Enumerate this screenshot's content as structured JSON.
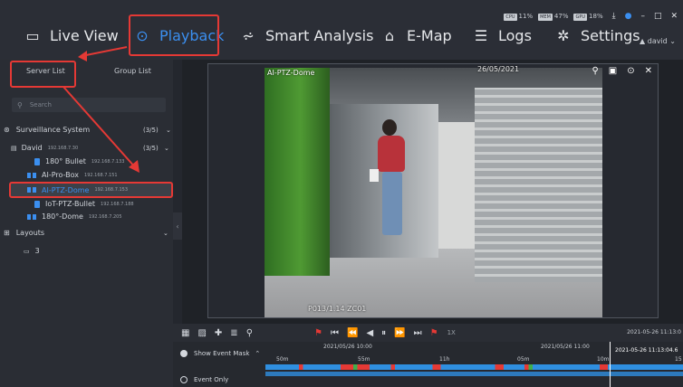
{
  "topbar": {
    "tabs": [
      {
        "label": "Live View",
        "icon": "monitor-icon"
      },
      {
        "label": "Playback",
        "icon": "playback-icon"
      },
      {
        "label": "Smart Analysis",
        "icon": "analysis-icon"
      },
      {
        "label": "E-Map",
        "icon": "emap-icon"
      },
      {
        "label": "Logs",
        "icon": "logs-icon"
      },
      {
        "label": "Settings",
        "icon": "gear-icon"
      }
    ],
    "status": {
      "cpu": "11%",
      "mem": "47%",
      "gpu": "18%"
    },
    "user": "david"
  },
  "sidebar": {
    "tabs": [
      {
        "label": "Server List"
      },
      {
        "label": "Group List"
      }
    ],
    "search_placeholder": "Search",
    "tree": {
      "root_label": "Surveillance System",
      "root_count": "(3/5)",
      "server_label": "David",
      "server_ip": "192.168.7.30",
      "server_count": "(3/5)",
      "devices": [
        {
          "name": "180° Bullet",
          "ip": "192.168.7.133"
        },
        {
          "name": "AI-Pro-Box",
          "ip": "192.168.7.151"
        },
        {
          "name": "AI-PTZ-Dome",
          "ip": "192.168.7.153"
        },
        {
          "name": "IoT-PTZ-Bullet",
          "ip": "192.168.7.188"
        },
        {
          "name": "180°-Dome",
          "ip": "192.168.7.205"
        }
      ],
      "layouts_label": "Layouts",
      "layout_items": [
        "3"
      ]
    }
  },
  "video": {
    "title": "AI-PTZ-Dome",
    "timestamp_overlay": "26/05/2021",
    "bottom_overlay": "P013/1.14   ZC01"
  },
  "controls": {
    "speed": "1X",
    "current_time": "2021-05-26 11:13:0"
  },
  "timeline": {
    "show_event_mask_label": "Show Event Mask",
    "event_only_label": "Event Only",
    "date_1": "2021/05/26 10:00",
    "date_2": "2021/05/26 11:00",
    "ticks": [
      "50m",
      "55m",
      "11h",
      "05m",
      "10m",
      "15"
    ],
    "cursor_label": "2021-05-26 11:13:04.6"
  },
  "colors": {
    "accent": "#3b8ff0",
    "highlight": "#e53935",
    "event": "#e53935",
    "record": "#2f8fe0"
  }
}
